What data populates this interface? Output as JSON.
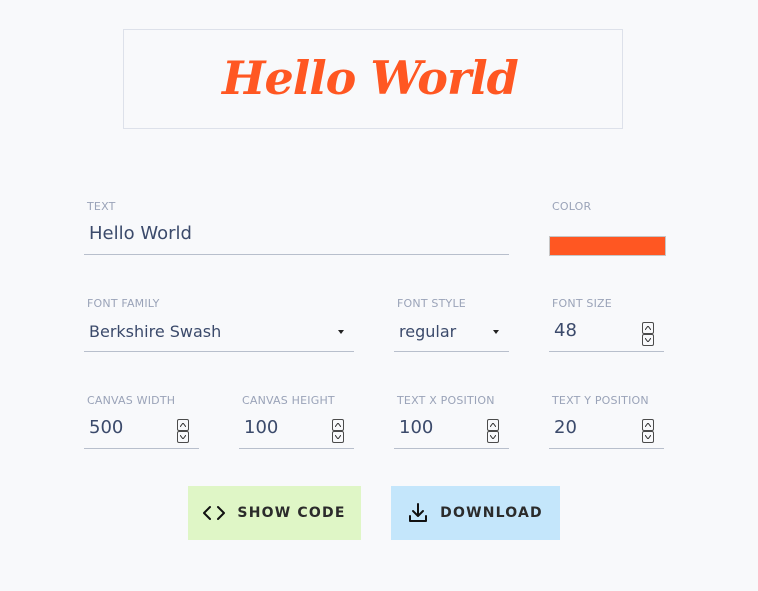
{
  "preview": {
    "text": "Hello World",
    "color": "#ff5722"
  },
  "fields": {
    "text": {
      "label": "TEXT",
      "value": "Hello World"
    },
    "color": {
      "label": "COLOR",
      "value": "#ff5722"
    },
    "font_family": {
      "label": "FONT FAMILY",
      "value": "Berkshire Swash"
    },
    "font_style": {
      "label": "FONT STYLE",
      "value": "regular"
    },
    "font_size": {
      "label": "FONT SIZE",
      "value": "48"
    },
    "canvas_width": {
      "label": "CANVAS WIDTH",
      "value": "500"
    },
    "canvas_height": {
      "label": "CANVAS HEIGHT",
      "value": "100"
    },
    "text_x": {
      "label": "TEXT X POSITION",
      "value": "100"
    },
    "text_y": {
      "label": "TEXT Y POSITION",
      "value": "20"
    }
  },
  "buttons": {
    "show_code": {
      "label": "SHOW CODE",
      "icon": "code-icon",
      "bg": "#dff6c6"
    },
    "download": {
      "label": "DOWNLOAD",
      "icon": "download-icon",
      "bg": "#c4e6fb"
    }
  }
}
